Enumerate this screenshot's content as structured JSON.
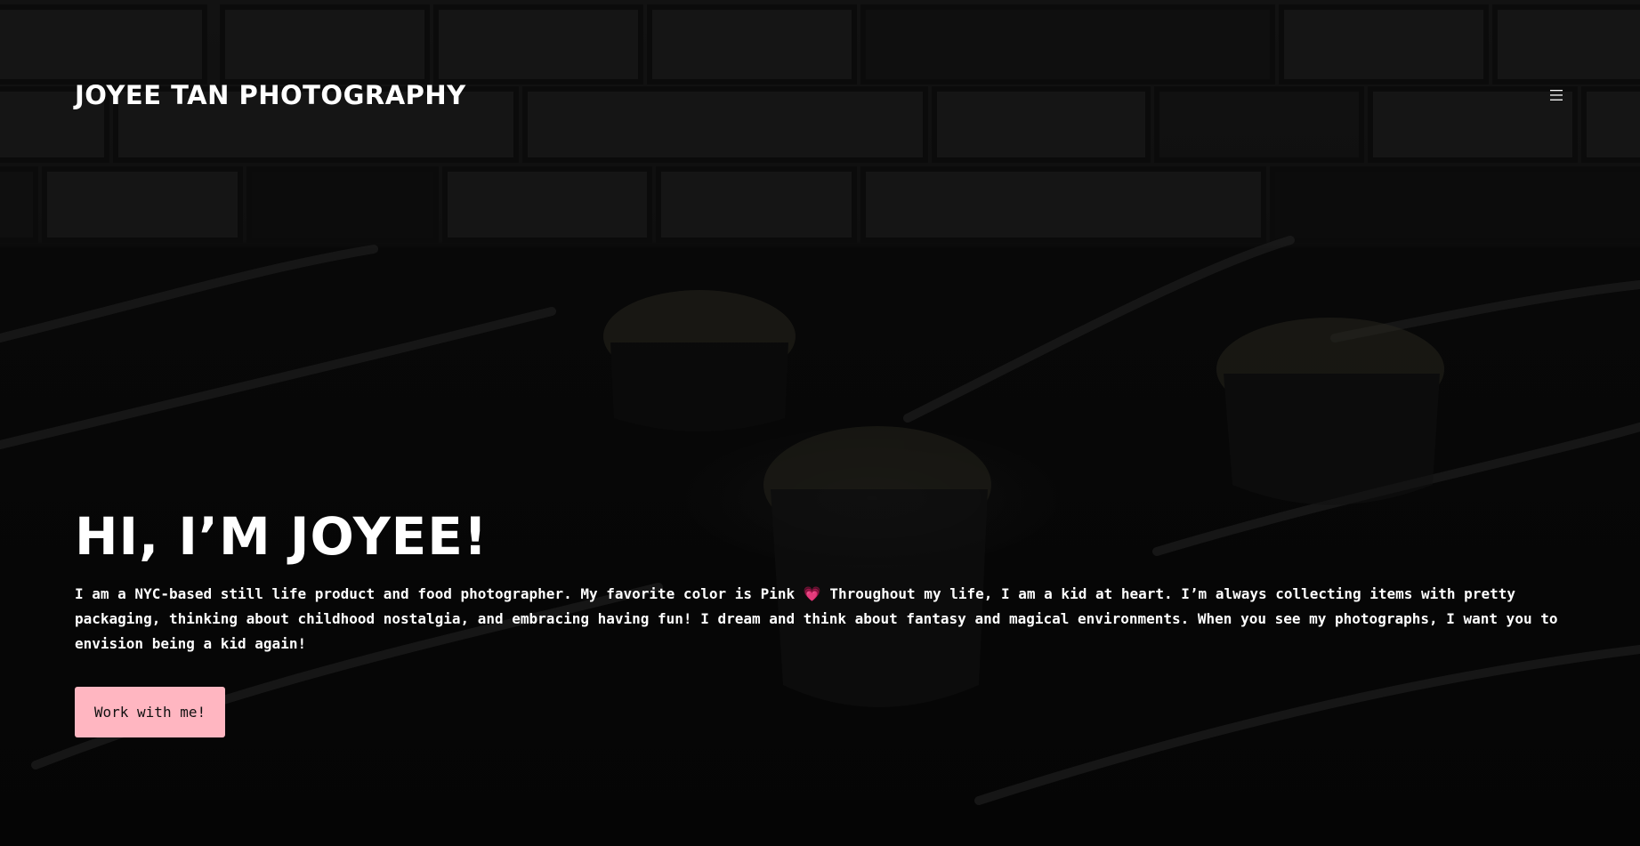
{
  "header": {
    "brand": "JOYEE TAN PHOTOGRAPHY",
    "menu_icon": "hamburger-menu-icon"
  },
  "hero": {
    "title": "HI, I’M JOYEE!",
    "body": "I am a NYC-based still life product and food photographer. My favorite color is Pink 💗 Throughout my life, I am a kid at heart. I’m always collecting items with pretty packaging, thinking about childhood nostalgia, and embracing having fun! I dream and think about fantasy and magical environments. When you see my photographs, I want you to envision being a kid again!",
    "cta_label": "Work with me!"
  },
  "colors": {
    "accent": "#ffb6c1",
    "background": "#0b0b0b",
    "text": "#ffffff"
  }
}
